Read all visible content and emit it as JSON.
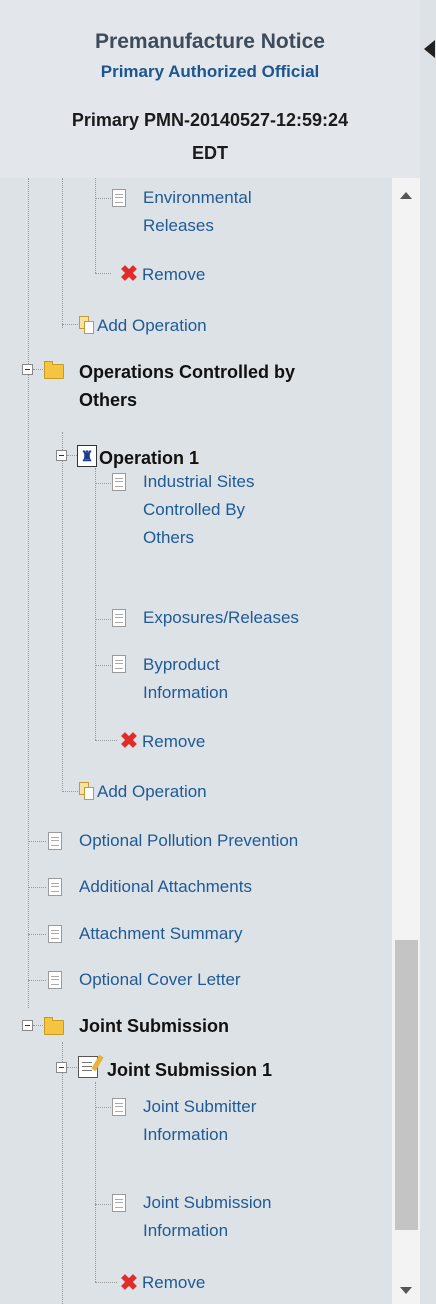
{
  "header": {
    "title": "Premanufacture Notice",
    "subtitle": "Primary Authorized Official",
    "pmn_line1": "Primary PMN-20140527-12:59:24",
    "pmn_line2": "EDT"
  },
  "tree": {
    "environmental_releases_1": "Environmental",
    "environmental_releases_2": "Releases",
    "remove_1": "Remove",
    "add_operation_1": "Add Operation",
    "ops_controlled_1": "Operations Controlled by",
    "ops_controlled_2": "Others",
    "operation_1": "Operation 1",
    "industrial_sites_1": "Industrial Sites",
    "industrial_sites_2": "Controlled By",
    "industrial_sites_3": "Others",
    "exposures_releases": "Exposures/Releases",
    "byproduct_1": "Byproduct",
    "byproduct_2": "Information",
    "remove_2": "Remove",
    "add_operation_2": "Add Operation",
    "optional_pollution_prevention": "Optional Pollution Prevention",
    "additional_attachments": "Additional Attachments",
    "attachment_summary": "Attachment Summary",
    "optional_cover_letter": "Optional Cover Letter",
    "joint_submission": "Joint Submission",
    "joint_submission_1": "Joint Submission 1",
    "joint_submitter_info_1": "Joint Submitter",
    "joint_submitter_info_2": "Information",
    "joint_submission_info_1": "Joint Submission",
    "joint_submission_info_2": "Information",
    "remove_3": "Remove"
  },
  "colors": {
    "panel_bg": "#dde2e7",
    "link": "#1f5a96",
    "remove_icon": "#e22b2b",
    "folder": "#f5c542"
  },
  "icons": {
    "document": "document-icon",
    "remove": "red-x-icon",
    "add": "add-operation-icon",
    "folder": "folder-icon",
    "operation": "operation-icon",
    "joint_submission": "joint-submission-icon",
    "collapse_panel": "collapse-left-arrow-icon"
  }
}
